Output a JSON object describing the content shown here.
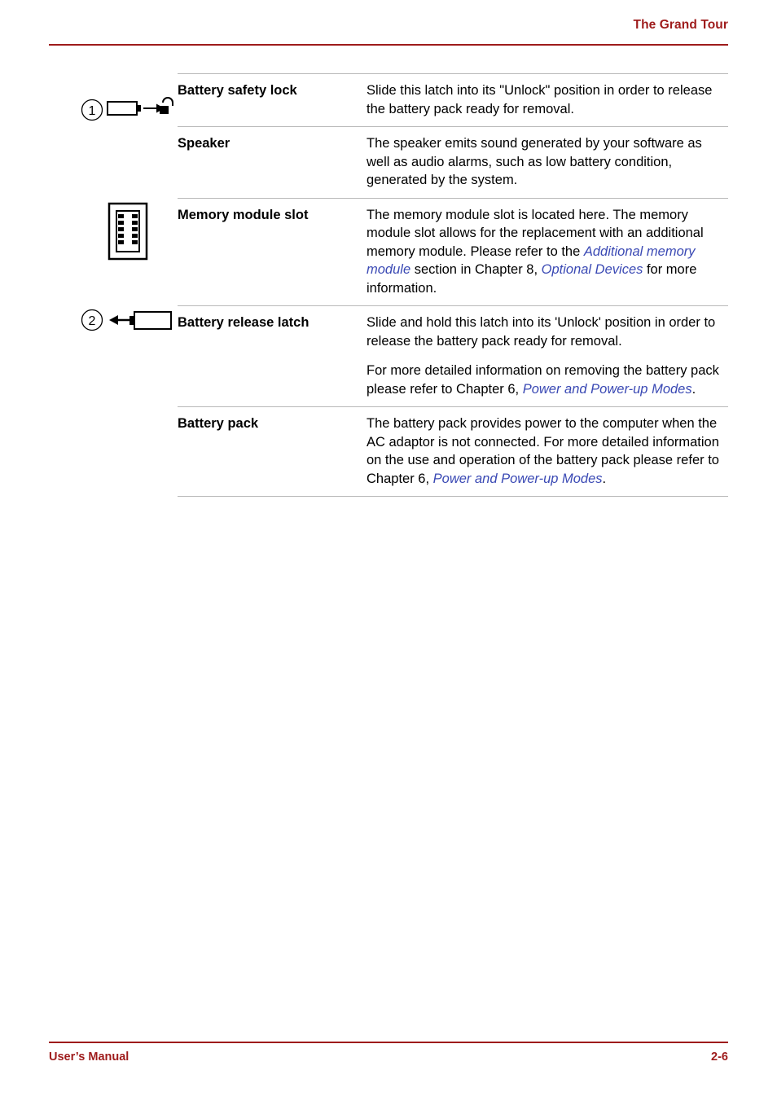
{
  "header": {
    "title": "The Grand Tour"
  },
  "footer": {
    "left": "User’s Manual",
    "right": "2-6"
  },
  "colors": {
    "accent": "#9e1b1b",
    "link": "#3a49b4",
    "rule": "#b9b9b9"
  },
  "table": {
    "rows": [
      {
        "icon": "battery-safety-lock-icon",
        "callout": "1",
        "term": "Battery safety lock",
        "paragraphs": [
          [
            {
              "t": "Slide this latch into its \"Unlock\" position in order to release the battery pack ready for removal.",
              "s": "plain"
            }
          ]
        ]
      },
      {
        "icon": "",
        "callout": "",
        "term": "Speaker",
        "paragraphs": [
          [
            {
              "t": "The speaker emits sound generated by your software as well as audio alarms, such as low battery condition, generated by the system.",
              "s": "plain"
            }
          ]
        ]
      },
      {
        "icon": "memory-module-icon",
        "callout": "",
        "term": "Memory module slot",
        "paragraphs": [
          [
            {
              "t": "The memory module slot is located here. The memory module slot allows for the replacement with an additional memory module. Please refer to the ",
              "s": "plain"
            },
            {
              "t": "Additional memory module",
              "s": "link"
            },
            {
              "t": " section in Chapter 8, ",
              "s": "plain"
            },
            {
              "t": "Optional Devices",
              "s": "link"
            },
            {
              "t": " for more information.",
              "s": "plain"
            }
          ]
        ]
      },
      {
        "icon": "battery-release-latch-icon",
        "callout": "2",
        "term": "Battery release latch",
        "paragraphs": [
          [
            {
              "t": "Slide and hold this latch into its 'Unlock' position in order to release the battery pack ready for removal.",
              "s": "plain"
            }
          ],
          [
            {
              "t": "For more detailed information on removing the battery pack please refer to Chapter 6, ",
              "s": "plain"
            },
            {
              "t": "Power and Power-up Modes",
              "s": "link"
            },
            {
              "t": ".",
              "s": "plain"
            }
          ]
        ]
      },
      {
        "icon": "",
        "callout": "",
        "term": "Battery pack",
        "paragraphs": [
          [
            {
              "t": "The battery pack provides power to the computer when the AC adaptor is not connected. For more detailed information on the use and operation of the battery pack please refer to Chapter 6, ",
              "s": "plain"
            },
            {
              "t": "Power and Power-up Modes",
              "s": "link"
            },
            {
              "t": ".",
              "s": "plain"
            }
          ]
        ]
      }
    ]
  }
}
